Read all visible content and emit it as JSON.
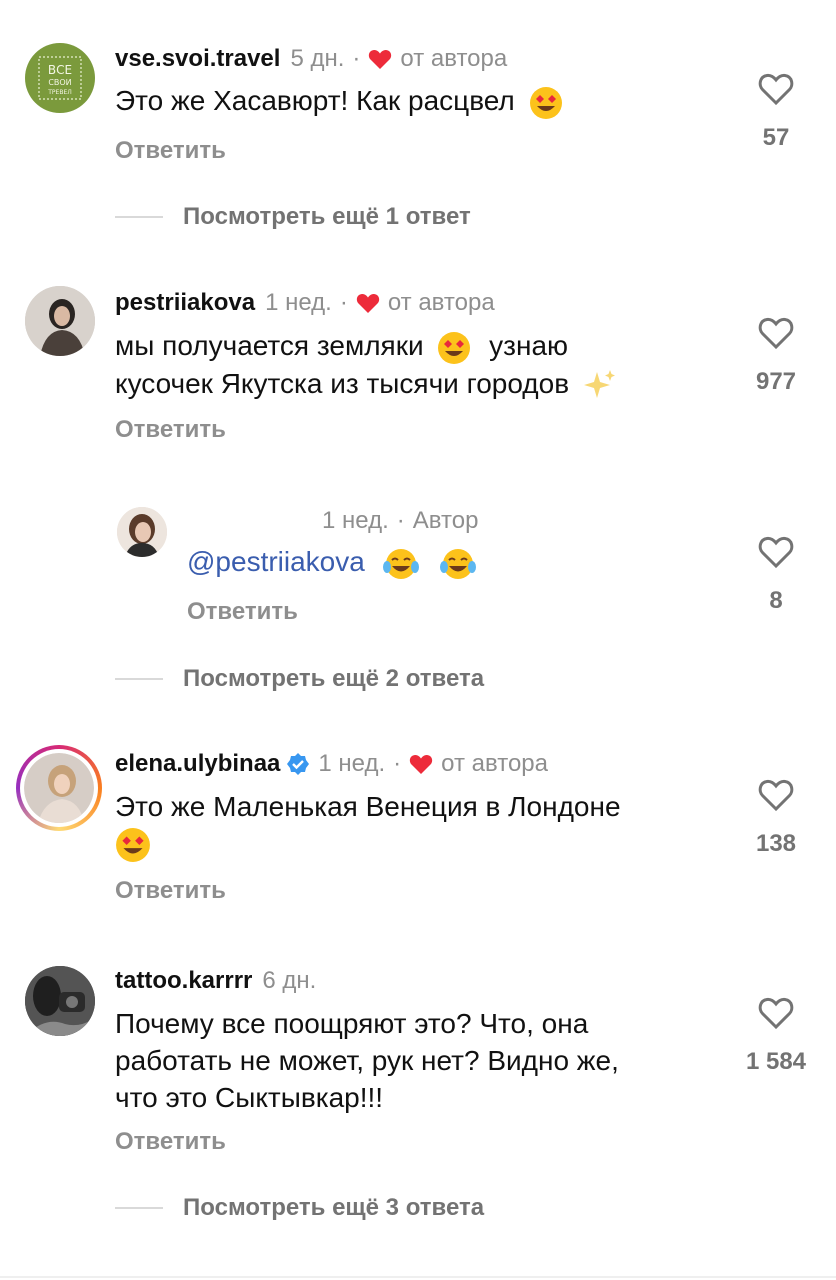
{
  "comments": [
    {
      "user": "vse.svoi.travel",
      "time": "5 дн.",
      "liked_by_author": "от автора",
      "text": "Это же Хасавюрт! Как расцвел",
      "likes": "57",
      "reply": "Ответить",
      "more": "Посмотреть ещё 1 ответ",
      "avatar_text": "ВСЕ СВОИ ТРЕВЕЛ"
    },
    {
      "user": "pestriiakova",
      "time": "1 нед.",
      "liked_by_author": "от автора",
      "text_line1": "мы получается земляки",
      "text_line1b": "узнаю",
      "text_line2": "кусочек Якутска из тысячи городов",
      "likes": "977",
      "reply": "Ответить"
    },
    {
      "user": "",
      "time": "1 нед.",
      "author_label": "Автор",
      "mention": "@pestriiakova",
      "likes": "8",
      "reply": "Ответить",
      "more": "Посмотреть ещё 2 ответа"
    },
    {
      "user": "elena.ulybinaa",
      "time": "1 нед.",
      "liked_by_author": "от автора",
      "text": "Это же Маленькая Венеция в Лондоне",
      "likes": "138",
      "reply": "Ответить"
    },
    {
      "user": "tattoo.karrrr",
      "time": "6 дн.",
      "text_line1": "Почему все поощряют это? Что, она",
      "text_line2": "работать не может, рук нет? Видно же,",
      "text_line3": "что это Сыктывкар!!!",
      "likes": "1 584",
      "reply": "Ответить",
      "more": "Посмотреть ещё 3 ответа"
    }
  ],
  "colors": {
    "heart_red": "#ed2b3a",
    "verified_blue": "#3897f0",
    "mention_blue": "#3a5dae",
    "meta_gray": "#8e8e8e"
  }
}
